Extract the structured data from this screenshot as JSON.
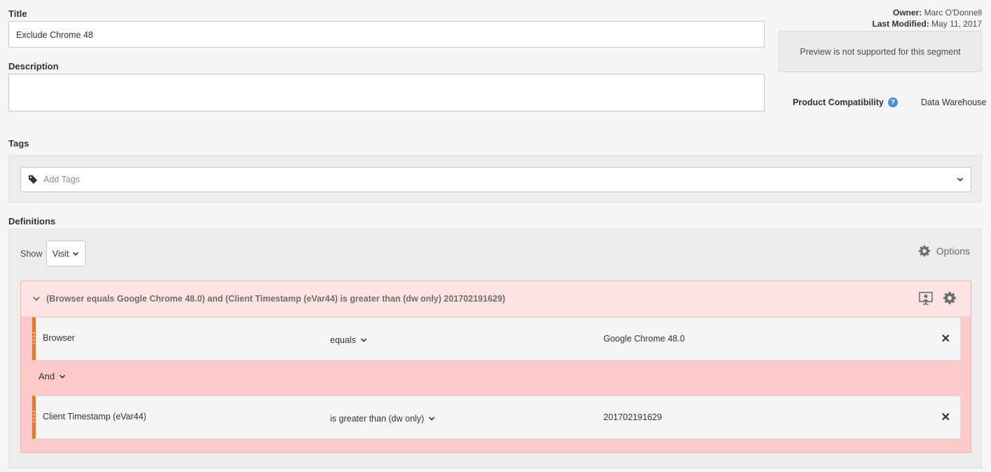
{
  "form": {
    "title_label": "Title",
    "title_value": "Exclude Chrome 48",
    "description_label": "Description",
    "description_value": "",
    "tags_label": "Tags",
    "tags_placeholder": "Add Tags",
    "definitions_label": "Definitions"
  },
  "meta": {
    "owner_label": "Owner:",
    "owner_value": "Marc O'Donnell",
    "modified_label": "Last Modified:",
    "modified_value": "May 11, 2017"
  },
  "preview": {
    "message": "Preview is not supported for this segment"
  },
  "compatibility": {
    "label": "Product Compatibility",
    "help_glyph": "?",
    "value": "Data Warehouse"
  },
  "definitions": {
    "show_label": "Show",
    "show_value": "Visit",
    "options_label": "Options",
    "container_summary": "(Browser equals Google Chrome 48.0) and (Client Timestamp (eVar44) is greater than (dw only) 201702191629)",
    "logic_operator": "And",
    "rules": [
      {
        "dimension": "Browser",
        "operator": "equals",
        "value": "Google Chrome 48.0",
        "remove": "✕"
      },
      {
        "dimension": "Client Timestamp (eVar44)",
        "operator": "is greater than (dw only)",
        "value": "201702191629",
        "remove": "✕"
      }
    ]
  },
  "colors": {
    "accent_orange": "#e87722",
    "container_fill": "#fdcac9",
    "container_header": "#fde3e3",
    "help_blue": "#4a90d9"
  }
}
